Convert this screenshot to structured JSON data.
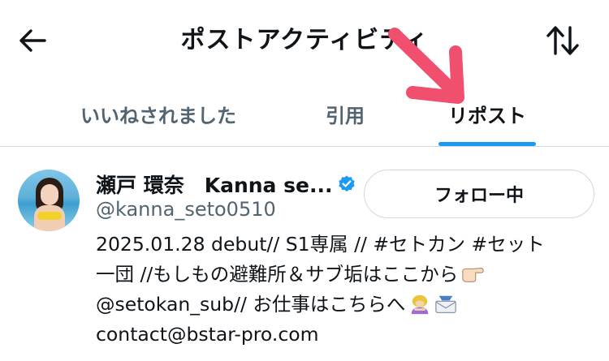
{
  "header": {
    "title": "ポストアクティビティ",
    "back_icon": "arrow-left-icon",
    "sort_icon": "sort-arrows-icon"
  },
  "annotation": {
    "arrow_color": "#f0506e"
  },
  "tabs": [
    {
      "label": "いいねされました",
      "active": false
    },
    {
      "label": "引用",
      "active": false
    },
    {
      "label": "リポスト",
      "active": true
    }
  ],
  "accent_color": "#1d9bf0",
  "user": {
    "display_name": "瀬戸 環奈　Kanna se...",
    "handle": "@kanna_seto0510",
    "verified": true,
    "follow_button_label": "フォロー中",
    "bio_lines": [
      "2025.01.28 debut// S1専属 // #セトカン #セット",
      "一団 //もしもの避難所＆サブ垢はここから",
      "@setokan_sub// お仕事はこちらへ",
      "contact@bstar-pro.com"
    ],
    "bio_emoji": [
      "pointing-right-icon",
      "woman-bowing-icon",
      "envelope-icon"
    ]
  }
}
